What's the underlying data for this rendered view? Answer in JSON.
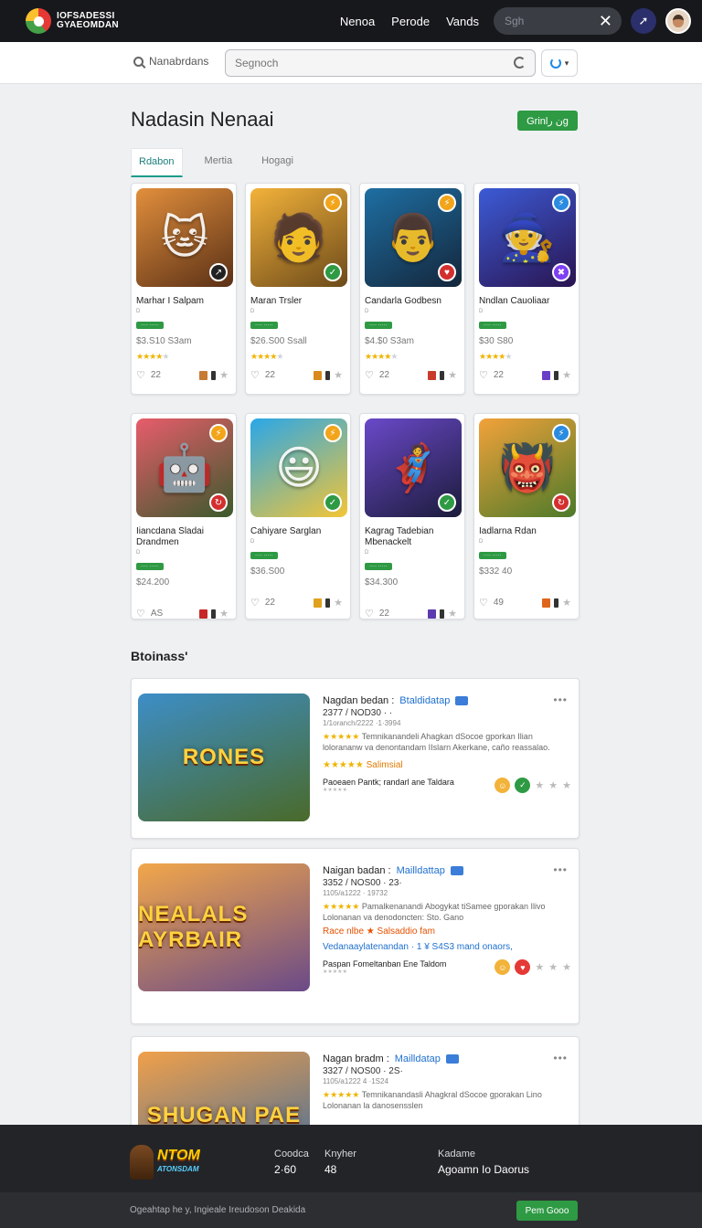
{
  "brand": {
    "line1": "IOFSADESSI",
    "line2": "GYAEOMDAN"
  },
  "topnav": {
    "items": [
      "Nenoa",
      "Perode",
      "Vands"
    ]
  },
  "top_search": {
    "placeholder": "Sgh"
  },
  "subbar": {
    "search_label": "Nanabrdans",
    "input_placeholder": "Segnoch"
  },
  "page": {
    "title": "Nadasin Nenaai",
    "primary_button": "Grinlن رg"
  },
  "tabs": [
    "Rdabon",
    "Mertia",
    "Hogagi"
  ],
  "cards": [
    {
      "title": "Marhar I Salpam",
      "sub": "D       ",
      "badge": "···· ·····",
      "price": "$3.S10 S3am",
      "rating": 4,
      "likes": "22",
      "accent": "#c77a33",
      "art": "#e28f3c",
      "art2": "#5a3016",
      "glyph": "🐱",
      "corner": "#222",
      "corner_glyph": "↗"
    },
    {
      "title": "Maran Trsler",
      "sub": "D       ",
      "badge": "···· ·····",
      "price": "$26.S00 Ssall",
      "rating": 4,
      "likes": "22",
      "accent": "#d88b1c",
      "art": "#f3b23a",
      "art2": "#6c4a1a",
      "glyph": "🧑",
      "corner": "#2e9a44",
      "corner_glyph": "✓"
    },
    {
      "title": "Candarla Godbesn",
      "sub": "D       ",
      "badge": "···· ·····",
      "price": "$4.$0 S3am",
      "rating": 4,
      "likes": "22",
      "accent": "#c83b2b",
      "art": "#1e6fa3",
      "art2": "#14263b",
      "glyph": "👨",
      "corner": "#d32f2f",
      "corner_glyph": "♥"
    },
    {
      "title": "Nndlan Cauoliaar",
      "sub": "D       ",
      "badge": "···· ·····",
      "price": "$30 S80",
      "rating": 4,
      "likes": "22",
      "accent": "#6a3fc7",
      "art": "#3c5bd6",
      "art2": "#2a1450",
      "glyph": "🧙",
      "corner": "#7e3ff2",
      "corner_glyph": "✖"
    },
    {
      "title": "Iiancdana Sladai Drandmen",
      "sub": "D       ",
      "badge": "···· ·····",
      "price": "$24.200",
      "rating": 0,
      "likes": "AS",
      "accent": "#c62828",
      "art": "#e85c6b",
      "art2": "#3b5a2c",
      "glyph": "🤖",
      "corner": "#d32f2f",
      "corner_glyph": "↻"
    },
    {
      "title": "Cahiyare Sarglan",
      "sub": "D       ",
      "badge": "···· ·····",
      "price": "$36.S00",
      "rating": 0,
      "likes": "22",
      "accent": "#e1a11c",
      "art": "#2aa7e8",
      "art2": "#f3c536",
      "glyph": "😃",
      "corner": "#2e9a44",
      "corner_glyph": "✓"
    },
    {
      "title": "Kagrag Tadebian Mbenackelt",
      "sub": "D       ",
      "badge": "···· ·····",
      "price": "$34.300",
      "rating": 0,
      "likes": "22",
      "accent": "#5c3bb0",
      "art": "#6a49c9",
      "art2": "#1b1b3a",
      "glyph": "🦸",
      "corner": "#2e9a44",
      "corner_glyph": "✓"
    },
    {
      "title": "Iadlarna Rdan",
      "sub": "D       ",
      "badge": "···· ·····",
      "price": "$332 40",
      "rating": 0,
      "likes": "49",
      "accent": "#e0651c",
      "art": "#f2a23a",
      "art2": "#4c7a2a",
      "glyph": "👹",
      "corner": "#d32f2f",
      "corner_glyph": "↻"
    }
  ],
  "section": {
    "title": "Btoinass'"
  },
  "listings": [
    {
      "title": "Nagdan bedan :",
      "title_link": "Btaldidatap",
      "tag": " ",
      "meta": "2377 / NOD30 · ·",
      "sub": "1/1oranch/2222 ·1·3994",
      "desc": "Temnikanandeli Ahagkan dSocoe gporkan Ilian lolorananw va denontandam IIslarn Akerkane, caño reassalao.",
      "rating_label": "Salimsial",
      "promo": "",
      "link": "",
      "footer": "Paoeaen Pantk; randarl ane Taldara",
      "thumb_text": "RONES",
      "thumb_a": "#3d8ec7",
      "thumb_b": "#4a6a2a"
    },
    {
      "title": "Naigan badan :",
      "title_link": "Mailldattap",
      "tag": " ",
      "meta": "3352 / NOS00 · 23·",
      "sub": "1105/a1222 · 19732",
      "desc": "Pamalkenanandi Abogykat tiSamee gporakan Ilivo Lolonanan va denodoncten: Sto. Gano",
      "rating_label": "",
      "promo": "Race nlbe ★ Salsaddio fam",
      "link": "Vedanaaylatenandan · 1 ¥ S4S3 mand onaors,",
      "footer": "Paspan Fomeltanban Ene Taldom",
      "thumb_text": "NEALALS AYRBAIR",
      "thumb_a": "#f2a74a",
      "thumb_b": "#6a4a88"
    },
    {
      "title": "Nagan bradm :",
      "title_link": "Mailldatap",
      "tag": " ",
      "meta": "3327 / NOS00 · 2S·",
      "sub": "1105/a1222 4 ·1S24",
      "desc": "Temnikanandasli Ahagkral dSocoe gporakan Lino Lolonanan la danosensslen",
      "rating_label": "",
      "promo": "",
      "link": "",
      "footer": "",
      "thumb_text": "SHUGAN PAE",
      "thumb_a": "#f0a04a",
      "thumb_b": "#3a6aa0"
    }
  ],
  "footer": {
    "brand_line1": "NTOM",
    "brand_line2": "ATONSDAM",
    "stat1_label": "Coodca",
    "stat1_value": "2·60",
    "stat2_label": "Knyher",
    "stat2_value": "48",
    "stat3_label": "Kadame",
    "stat3_value": "Agoamn Io Daorus",
    "note": "Ogeahtap he y, Ingieale Ireudoson Deakida",
    "button": "Pem Gooo"
  }
}
